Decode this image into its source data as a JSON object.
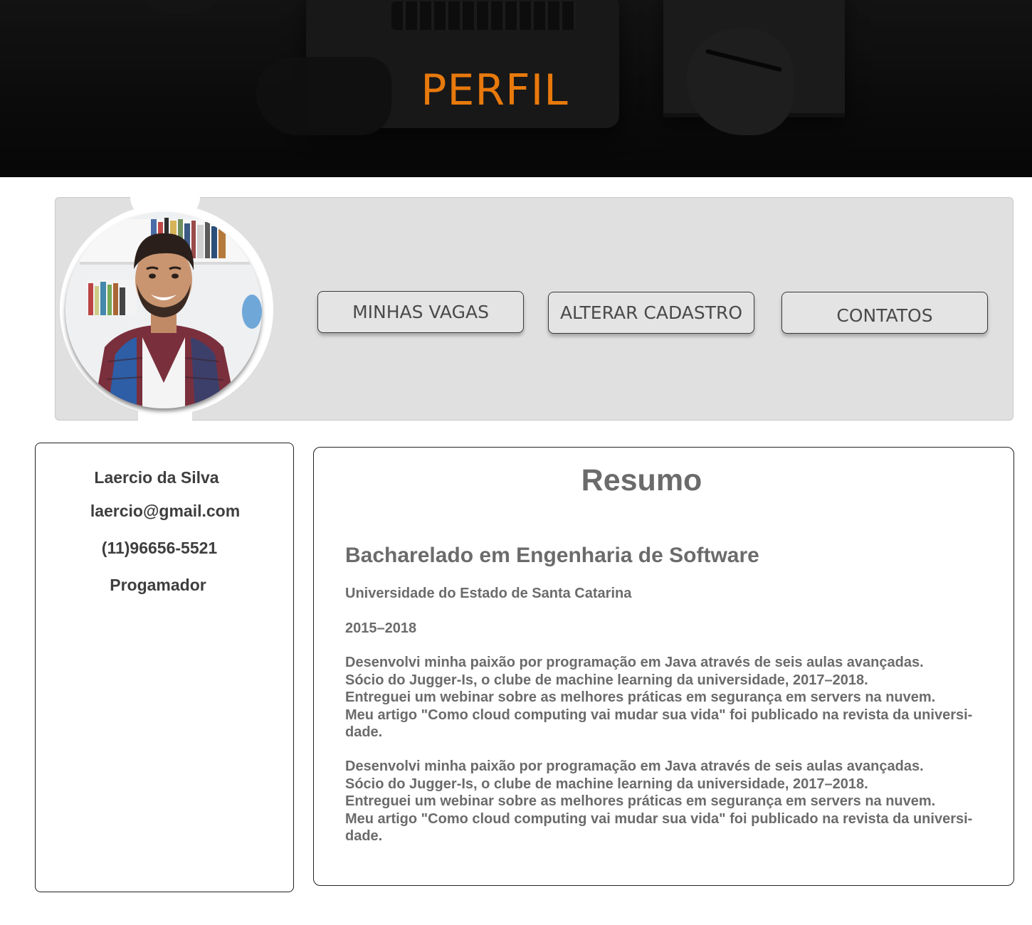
{
  "header": {
    "title": "PERFIL",
    "title_color": "#e8790c"
  },
  "nav": {
    "minhas_vagas": "MINHAS VAGAS",
    "alterar_cadastro": "ALTERAR CADASTRO",
    "contatos": "CONTATOS"
  },
  "profile": {
    "name": "Laercio da Silva",
    "email": "laercio@gmail.com",
    "phone": "(11)96656-5521",
    "role": "Progamador"
  },
  "resumo": {
    "title": "Resumo",
    "degree": "Bacharelado em Engenharia de Software",
    "school": "Universidade do Estado de Santa Catarina",
    "years": "2015–2018",
    "paragraph_1": [
      "Desenvolvi minha paixão por programação em Java através de seis aulas avançadas.",
      "Sócio do Jugger-Is, o clube de machine learning da universidade, 2017–2018.",
      "Entreguei um webinar sobre as melhores práticas em segurança em servers na nuvem.",
      "Meu artigo \"Como cloud computing vai mudar sua vida\" foi publicado na revista da universi-",
      "dade."
    ],
    "paragraph_2": [
      "Desenvolvi minha paixão por programação em Java através de seis aulas avançadas.",
      "Sócio do Jugger-Is, o clube de machine learning da universidade, 2017–2018.",
      "Entreguei um webinar sobre as melhores práticas em segurança em servers na nuvem.",
      "Meu artigo \"Como cloud computing vai mudar sua vida\" foi publicado na revista da universi-",
      "dade."
    ]
  }
}
